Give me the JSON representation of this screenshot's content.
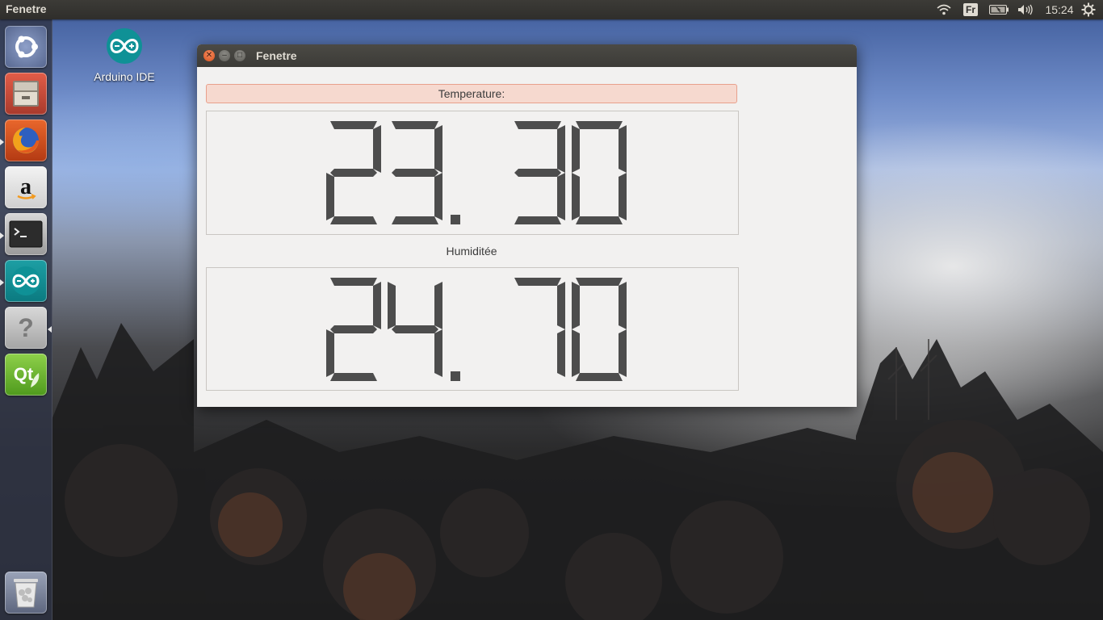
{
  "top_panel": {
    "app_title": "Fenetre",
    "keyboard_layout": "Fr",
    "clock": "15:24",
    "icons": [
      "wifi-icon",
      "keyboard-layout-icon",
      "battery-icon",
      "volume-icon",
      "settings-gear-icon"
    ]
  },
  "launcher": {
    "items": [
      {
        "name": "ubuntu-dash",
        "icon": "ubuntu-logo-icon"
      },
      {
        "name": "files",
        "icon": "file-cabinet-icon"
      },
      {
        "name": "firefox",
        "icon": "firefox-icon"
      },
      {
        "name": "amazon",
        "icon": "amazon-a-icon"
      },
      {
        "name": "terminal",
        "icon": "terminal-icon"
      },
      {
        "name": "arduino",
        "icon": "arduino-icon"
      },
      {
        "name": "help",
        "icon": "question-mark-icon"
      },
      {
        "name": "qt-creator",
        "icon": "qt-logo-icon"
      },
      {
        "name": "trash",
        "icon": "trash-icon"
      }
    ]
  },
  "desktop": {
    "icon_label": "Arduino IDE"
  },
  "window": {
    "title": "Fenetre",
    "temperature_label": "Temperature:",
    "temperature_value": "23.30",
    "humidity_label": "Humiditée",
    "humidity_value": "24.70",
    "lcd_color": "#4d4d4d"
  },
  "colors": {
    "accent_close": "#e35d25",
    "label_bg": "#f6d9cf",
    "window_bg": "#f2f1f0"
  }
}
